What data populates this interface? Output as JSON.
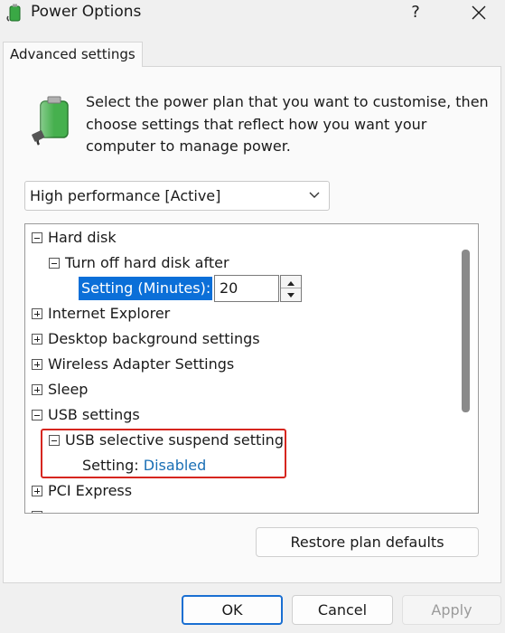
{
  "window": {
    "title": "Power Options",
    "help_label": "?",
    "icons": {
      "app": "power-options-icon",
      "close": "close-icon"
    }
  },
  "tab": {
    "label": "Advanced settings"
  },
  "intro": {
    "text": "Select the power plan that you want to customise, then choose settings that reflect how you want your computer to manage power."
  },
  "plan": {
    "selected": "High performance [Active]"
  },
  "tree": {
    "items": [
      {
        "label": "Hard disk",
        "state": "expanded"
      },
      {
        "label": "Turn off hard disk after",
        "state": "expanded"
      },
      {
        "label": "Internet Explorer",
        "state": "collapsed"
      },
      {
        "label": "Desktop background settings",
        "state": "collapsed"
      },
      {
        "label": "Wireless Adapter Settings",
        "state": "collapsed"
      },
      {
        "label": "Sleep",
        "state": "collapsed"
      },
      {
        "label": "USB settings",
        "state": "expanded"
      },
      {
        "label": "USB selective suspend setting",
        "state": "expanded"
      },
      {
        "label": "PCI Express",
        "state": "collapsed"
      }
    ],
    "hard_disk_setting": {
      "label": "Setting (Minutes):",
      "value": "20"
    },
    "usb_setting": {
      "label": "Setting:",
      "value": "Disabled"
    }
  },
  "buttons": {
    "restore": "Restore plan defaults",
    "ok": "OK",
    "cancel": "Cancel",
    "apply": "Apply"
  },
  "colors": {
    "accent": "#0b6fd8",
    "highlight_box": "#d6261f",
    "link_value": "#1a6fb5"
  }
}
